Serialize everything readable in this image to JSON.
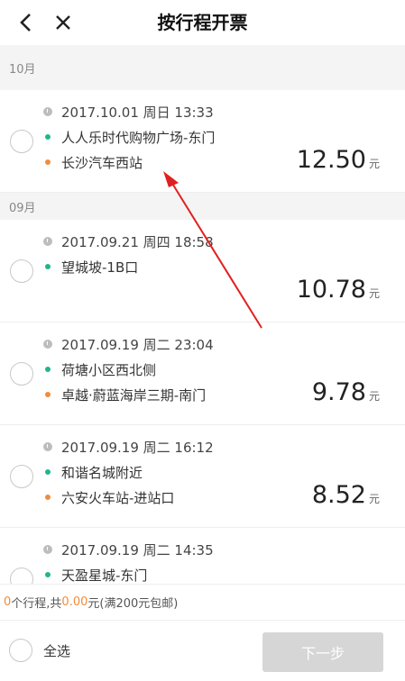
{
  "header": {
    "title": "按行程开票",
    "back_icon": "chevron-left-icon",
    "close_icon": "close-icon"
  },
  "months": {
    "oct": "10月",
    "sep": "09月"
  },
  "trips": [
    {
      "time": "2017.10.01 周日 13:33",
      "from": "人人乐时代购物广场-东门",
      "to": "长沙汽车西站",
      "amount": "12.50",
      "unit": "元"
    },
    {
      "time": "2017.09.21 周四 18:58",
      "from": "望城坡-1B口",
      "to": "",
      "amount": "10.78",
      "unit": "元"
    },
    {
      "time": "2017.09.19 周二 23:04",
      "from": "荷塘小区西北侧",
      "to": "卓越·蔚蓝海岸三期-南门",
      "amount": "9.78",
      "unit": "元"
    },
    {
      "time": "2017.09.19 周二 16:12",
      "from": "和谐名城附近",
      "to": "六安火车站-进站口",
      "amount": "8.52",
      "unit": "元"
    },
    {
      "time": "2017.09.19 周二 14:35",
      "from": "天盈星城-东门",
      "to": "",
      "amount": "",
      "unit": ""
    }
  ],
  "summary": {
    "count": "0",
    "count_suffix": "个行程,共",
    "total": "0.00",
    "total_suffix": "元(满200元包邮)"
  },
  "footer": {
    "select_all": "全选",
    "next": "下一步"
  },
  "colors": {
    "accent": "#f08c3c",
    "start_dot": "#21b48f",
    "end_dot": "#f08c3c",
    "annotation_arrow": "#e02020",
    "button_disabled": "#d6d6d6"
  }
}
